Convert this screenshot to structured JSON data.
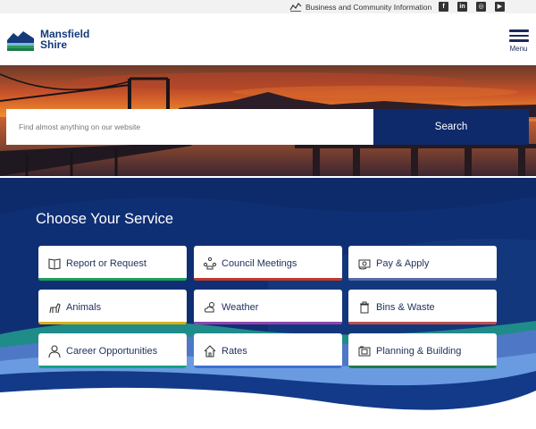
{
  "topbar": {
    "business_link": "Business and Community Information",
    "social": [
      {
        "icon": "facebook-icon",
        "glyph": "f"
      },
      {
        "icon": "linkedin-icon",
        "glyph": "in"
      },
      {
        "icon": "instagram-icon",
        "glyph": "◎"
      },
      {
        "icon": "youtube-icon",
        "glyph": "▶"
      }
    ]
  },
  "header": {
    "logo_line1": "Mansfield",
    "logo_line2": "Shire",
    "menu_label": "Menu"
  },
  "search": {
    "placeholder": "Find almost anything on our website",
    "button_label": "Search"
  },
  "services": {
    "title": "Choose Your Service",
    "items": [
      {
        "label": "Report or Request",
        "icon": "book-icon",
        "accent": "#1f9e5a"
      },
      {
        "label": "Council Meetings",
        "icon": "meeting-icon",
        "accent": "#c0392b"
      },
      {
        "label": "Pay & Apply",
        "icon": "payment-icon",
        "accent": "#5a6aa8"
      },
      {
        "label": "Animals",
        "icon": "dog-icon",
        "accent": "#d8b018"
      },
      {
        "label": "Weather",
        "icon": "weather-icon",
        "accent": "#8e44ad"
      },
      {
        "label": "Bins & Waste",
        "icon": "bin-icon",
        "accent": "#c0504d"
      },
      {
        "label": "Career Opportunities",
        "icon": "person-icon",
        "accent": "#16a085"
      },
      {
        "label": "Rates",
        "icon": "house-icon",
        "accent": "#3d6fd6"
      },
      {
        "label": "Planning & Building",
        "icon": "blueprint-icon",
        "accent": "#1e7a4a"
      }
    ]
  }
}
